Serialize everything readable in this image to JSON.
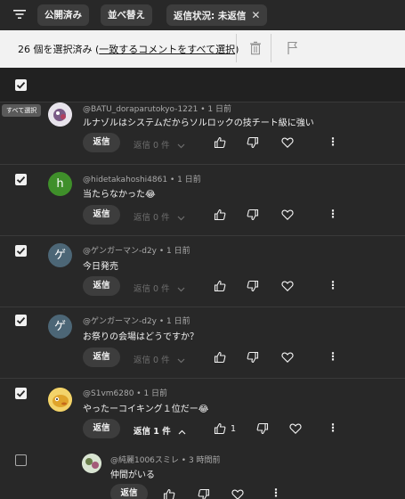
{
  "filters": {
    "published": "公開済み",
    "sort": "並べ替え",
    "reply_status": "返信状況: 未返信"
  },
  "selection": {
    "count_text": "26 個を選択済み (",
    "select_all_link": "一致するコメントをすべて選択",
    "close_paren": ")"
  },
  "header": {
    "select_all_tooltip": "すべて選択"
  },
  "reply_label": "返信",
  "comments": [
    {
      "author": "@BATU_doraparutokyo-1221",
      "time": "1 日前",
      "text": "ルナゾルはシステムだからソルロックの技チート級に強い",
      "reply_count": "返信 0 件",
      "avatar_letter": ""
    },
    {
      "author": "@hidetakahoshi4861",
      "time": "1 日前",
      "text": "当たらなかった😂",
      "reply_count": "返信 0 件",
      "avatar_letter": "h",
      "avatar_color": "#3f8f2a"
    },
    {
      "author": "@ゲンガーマン-d2y",
      "time": "1 日前",
      "text": "今日発売",
      "reply_count": "返信 0 件",
      "avatar_letter": "ゲ",
      "avatar_color": "#4c6676"
    },
    {
      "author": "@ゲンガーマン-d2y",
      "time": "1 日前",
      "text": "お祭りの会場はどうですか？",
      "reply_count": "返信 0 件",
      "avatar_letter": "ゲ",
      "avatar_color": "#4c6676"
    },
    {
      "author": "@S1vm6280",
      "time": "1 日前",
      "text": "やったーコイキング１位だー😂",
      "reply_count": "返信 1 件",
      "like_count": "1"
    }
  ],
  "reply": {
    "author": "@純麗1006スミレ",
    "time": "3 時間前",
    "text": "仲間がいる"
  },
  "colors": {
    "background": "#282828",
    "selection_bar": "#f2f2f2",
    "chip": "#3d3d3d",
    "muted_text": "#aaaaaa"
  }
}
